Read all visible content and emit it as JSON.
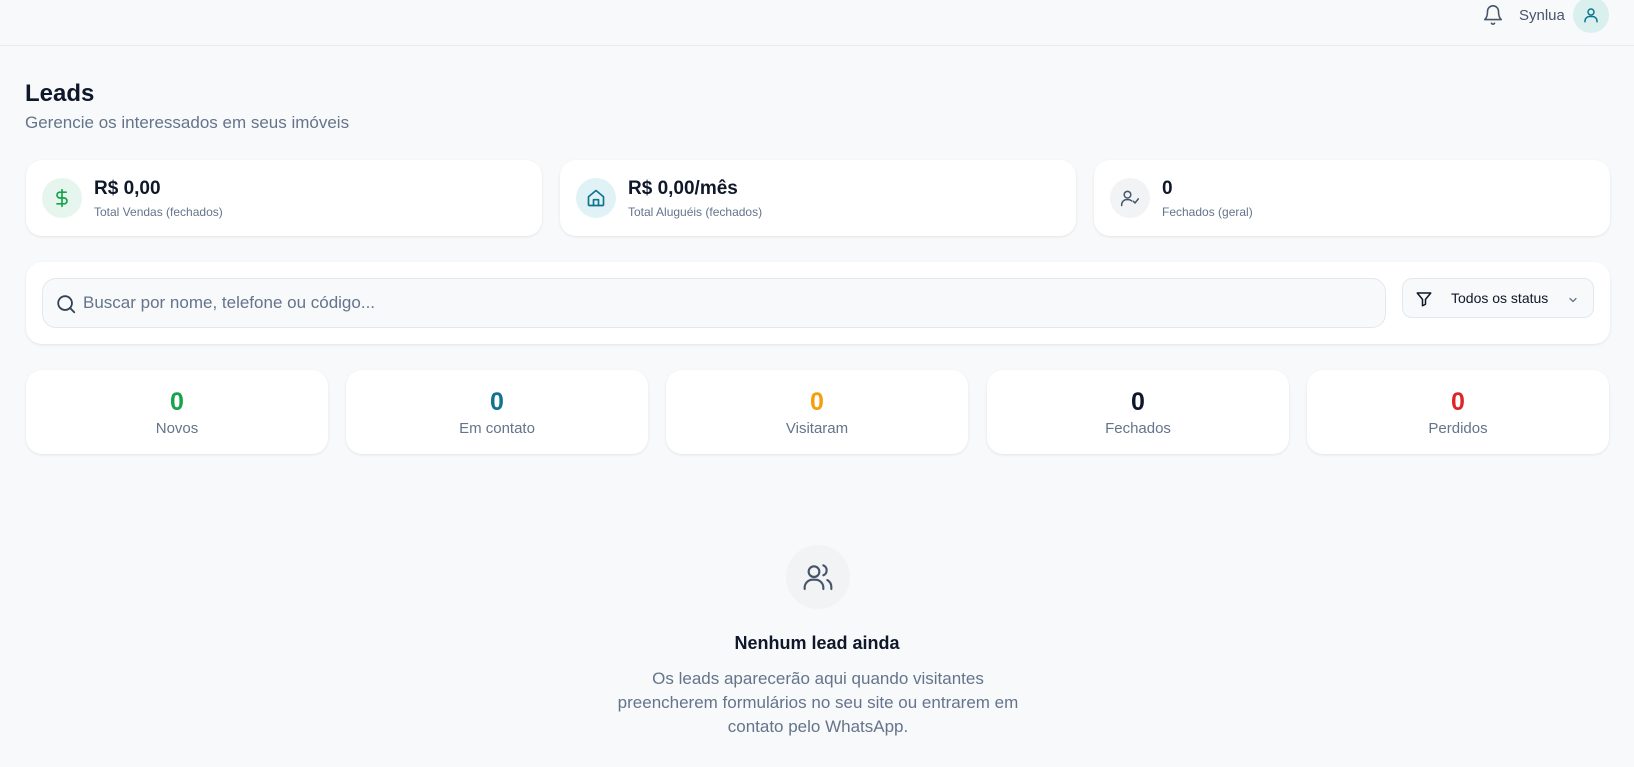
{
  "header": {
    "username": "Synlua",
    "icons": {
      "notifications": "bell-icon",
      "avatar": "user-icon"
    }
  },
  "page": {
    "title": "Leads",
    "subtitle": "Gerencie os interessados em seus imóveis"
  },
  "stats": [
    {
      "value": "R$ 0,00",
      "label": "Total Vendas (fechados)",
      "icon": "dollar-icon",
      "icon_color": "#16a34a",
      "icon_bg": "#e6f6ee"
    },
    {
      "value": "R$ 0,00/mês",
      "label": "Total Aluguéis (fechados)",
      "icon": "home-icon",
      "icon_color": "#0e7490",
      "icon_bg": "#e0f2f5"
    },
    {
      "value": "0",
      "label": "Fechados (geral)",
      "icon": "user-check-icon",
      "icon_color": "#475569",
      "icon_bg": "#f1f3f5"
    }
  ],
  "search": {
    "placeholder": "Buscar por nome, telefone ou código...",
    "value": "",
    "icon": "search-icon"
  },
  "status_filter": {
    "selected": "Todos os status",
    "icon": "filter-icon"
  },
  "status_counts": [
    {
      "value": "0",
      "label": "Novos",
      "color": "#16a34a"
    },
    {
      "value": "0",
      "label": "Em contato",
      "color": "#0e7490"
    },
    {
      "value": "0",
      "label": "Visitaram",
      "color": "#f59e0b"
    },
    {
      "value": "0",
      "label": "Fechados",
      "color": "#0f172a"
    },
    {
      "value": "0",
      "label": "Perdidos",
      "color": "#dc2626"
    }
  ],
  "empty_state": {
    "icon": "users-icon",
    "title": "Nenhum lead ainda",
    "description": "Os leads aparecerão aqui quando visitantes preencherem formulários no seu site ou entrarem em contato pelo WhatsApp."
  }
}
